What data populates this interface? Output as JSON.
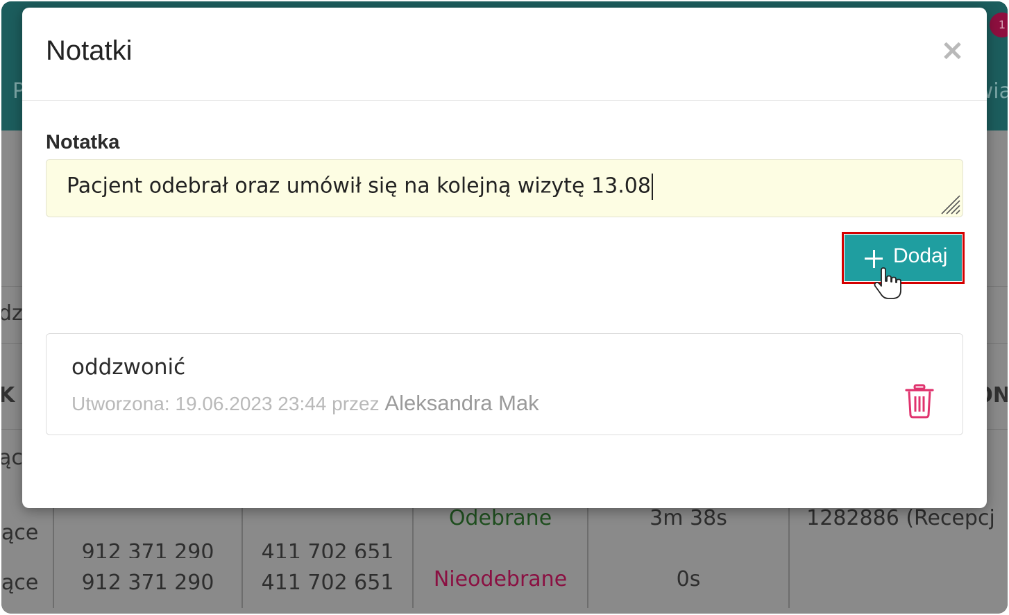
{
  "background": {
    "header_left": "P",
    "header_right": "wia",
    "badge": "1",
    "side_left_1": "dz",
    "side_left_2": "K",
    "side_left_3": "ące",
    "side_right": "ON",
    "rows": [
      {
        "type": "ące",
        "from": "912 371 290",
        "to": "411 702 651",
        "status": "Odebrane",
        "duration": "3m 38s",
        "who": "1282886 (Recepcj"
      },
      {
        "type": "ące",
        "from": "912 371 290",
        "to": "411 702 651",
        "status": "Nieodebrane",
        "duration": "0s",
        "who": ""
      }
    ]
  },
  "modal": {
    "title": "Notatki",
    "close_icon": "close-icon",
    "field_label": "Notatka",
    "note_value": "Pacjent odebrał oraz umówił się na kolejną wizytę 13.08",
    "add_button": {
      "label": "Dodaj",
      "icon": "plus-icon"
    },
    "notes": [
      {
        "text": "oddzwonić",
        "created_prefix": "Utworzona: 19.06.2023 23:44 przez",
        "author": "Aleksandra Mak",
        "delete_icon": "trash-icon"
      }
    ]
  },
  "colors": {
    "header": "#1c5d5d",
    "accent": "#1f9ea0",
    "highlight": "#d40000",
    "delete": "#e0336e",
    "input_bg": "#fdfde3"
  }
}
